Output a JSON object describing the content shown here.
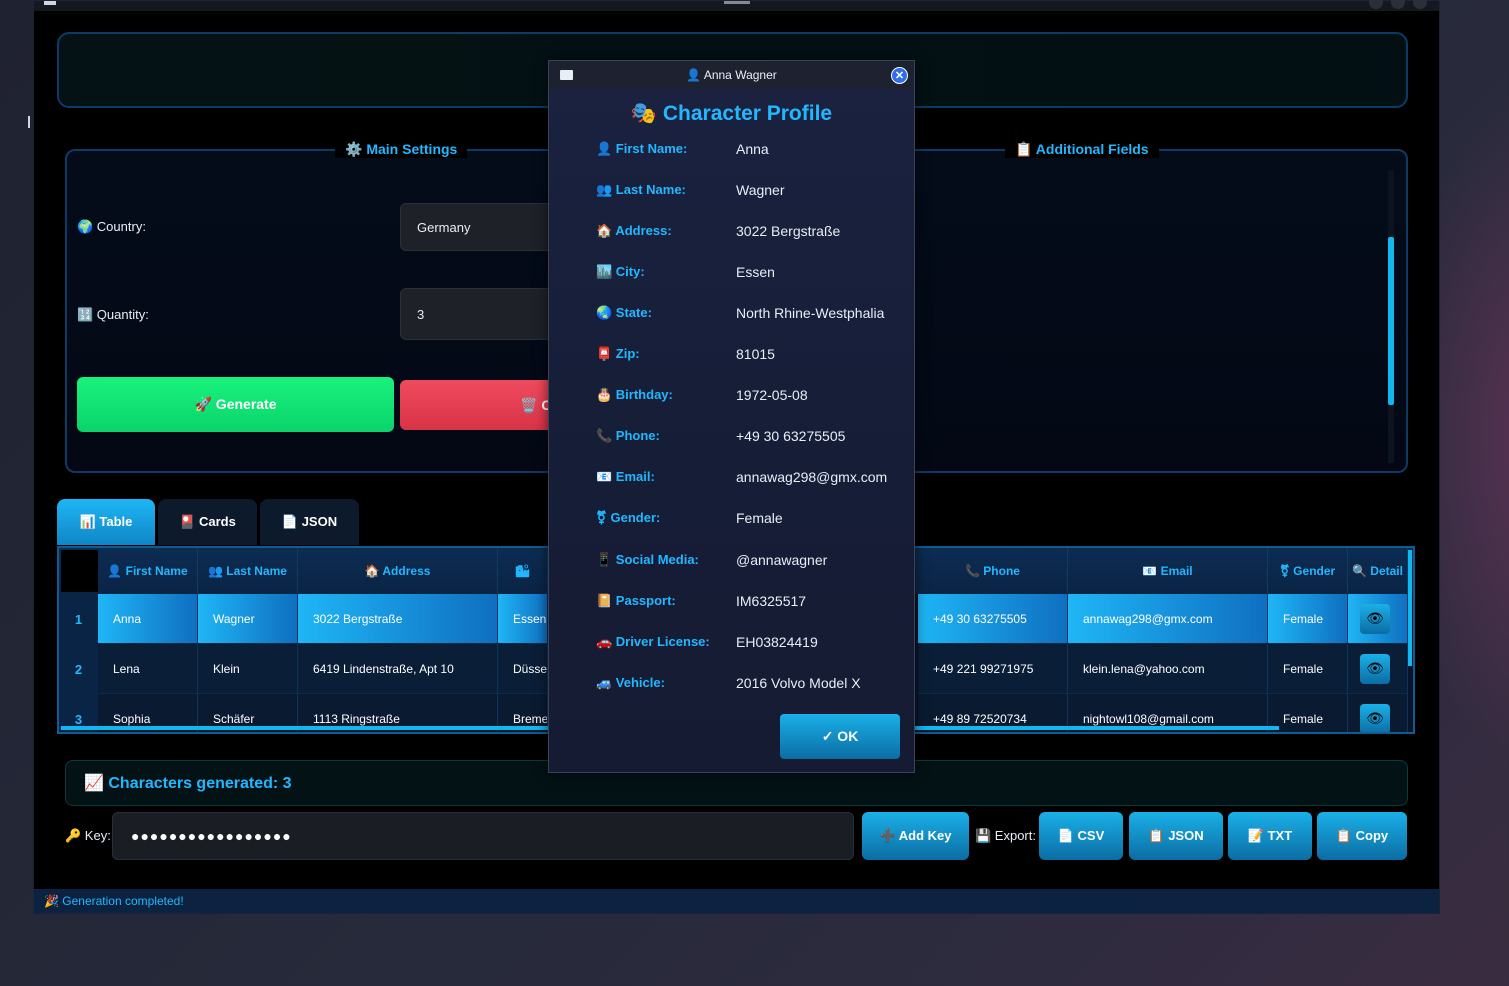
{
  "main_settings_title": "⚙️ Main Settings",
  "additional_fields_title": "📋 Additional Fields",
  "country_label": "🌍 Country:",
  "country_value": "Germany",
  "quantity_label": "🔢 Quantity:",
  "quantity_value": "3",
  "generate_label": "🚀 Generate",
  "clear_label": "🗑️ Cl",
  "tabs": [
    "📊 Table",
    "🎴 Cards",
    "📄 JSON"
  ],
  "table": {
    "headers": [
      "👤 First Name",
      "👥 Last Name",
      "🏠 Address",
      "🏙",
      "📞 Phone",
      "📧 Email",
      "⚧ Gender",
      "🔍 Detail"
    ],
    "rows": [
      {
        "num": "1",
        "first": "Anna",
        "last": "Wagner",
        "address": "3022 Bergstraße",
        "city": "Essen",
        "phone": "+49 30 63275505",
        "email": "annawag298@gmx.com",
        "gender": "Female"
      },
      {
        "num": "2",
        "first": "Lena",
        "last": "Klein",
        "address": "6419 Lindenstraße, Apt 10",
        "city": "Düssel",
        "phone": "+49 221 99271975",
        "email": "klein.lena@yahoo.com",
        "gender": "Female"
      },
      {
        "num": "3",
        "first": "Sophia",
        "last": "Schäfer",
        "address": "1113 Ringstraße",
        "city": "Breme",
        "phone": "+49 89 72520734",
        "email": "nightowl108@gmail.com",
        "gender": "Female"
      }
    ]
  },
  "status_text": "📈 Characters generated: 3",
  "key_label": "🔑 Key:",
  "key_value": "●●●●●●●●●●●●●●●●●",
  "add_key_label": "➕ Add Key",
  "export_label": "💾 Export:",
  "export_buttons": [
    "📄 CSV",
    "📋 JSON",
    "📝 TXT",
    "📋 Copy"
  ],
  "statusbar_text": "🎉 Generation completed!",
  "dialog": {
    "title": "👤 Anna Wagner",
    "heading": "🎭 Character Profile",
    "fields": [
      {
        "label": "👤 First Name:",
        "value": "Anna"
      },
      {
        "label": "👥 Last Name:",
        "value": "Wagner"
      },
      {
        "label": "🏠 Address:",
        "value": "3022 Bergstraße"
      },
      {
        "label": "🏙️ City:",
        "value": "Essen"
      },
      {
        "label": "🌏 State:",
        "value": "North Rhine-Westphalia"
      },
      {
        "label": "📮 Zip:",
        "value": "81015"
      },
      {
        "label": "🎂 Birthday:",
        "value": "1972-05-08"
      },
      {
        "label": "📞 Phone:",
        "value": "+49 30 63275505"
      },
      {
        "label": "📧 Email:",
        "value": "annawag298@gmx.com"
      },
      {
        "label": "⚧ Gender:",
        "value": "Female"
      },
      {
        "label": "📱 Social Media:",
        "value": "@annawagner"
      },
      {
        "label": "📔 Passport:",
        "value": "IM6325517"
      },
      {
        "label": "🚗 Driver License:",
        "value": "EH03824419"
      },
      {
        "label": "🚙 Vehicle:",
        "value": "2016 Volvo Model X"
      }
    ],
    "ok_label": "✓ OK",
    "close_symbol": "✕"
  },
  "icons": {
    "eye": "👁"
  }
}
